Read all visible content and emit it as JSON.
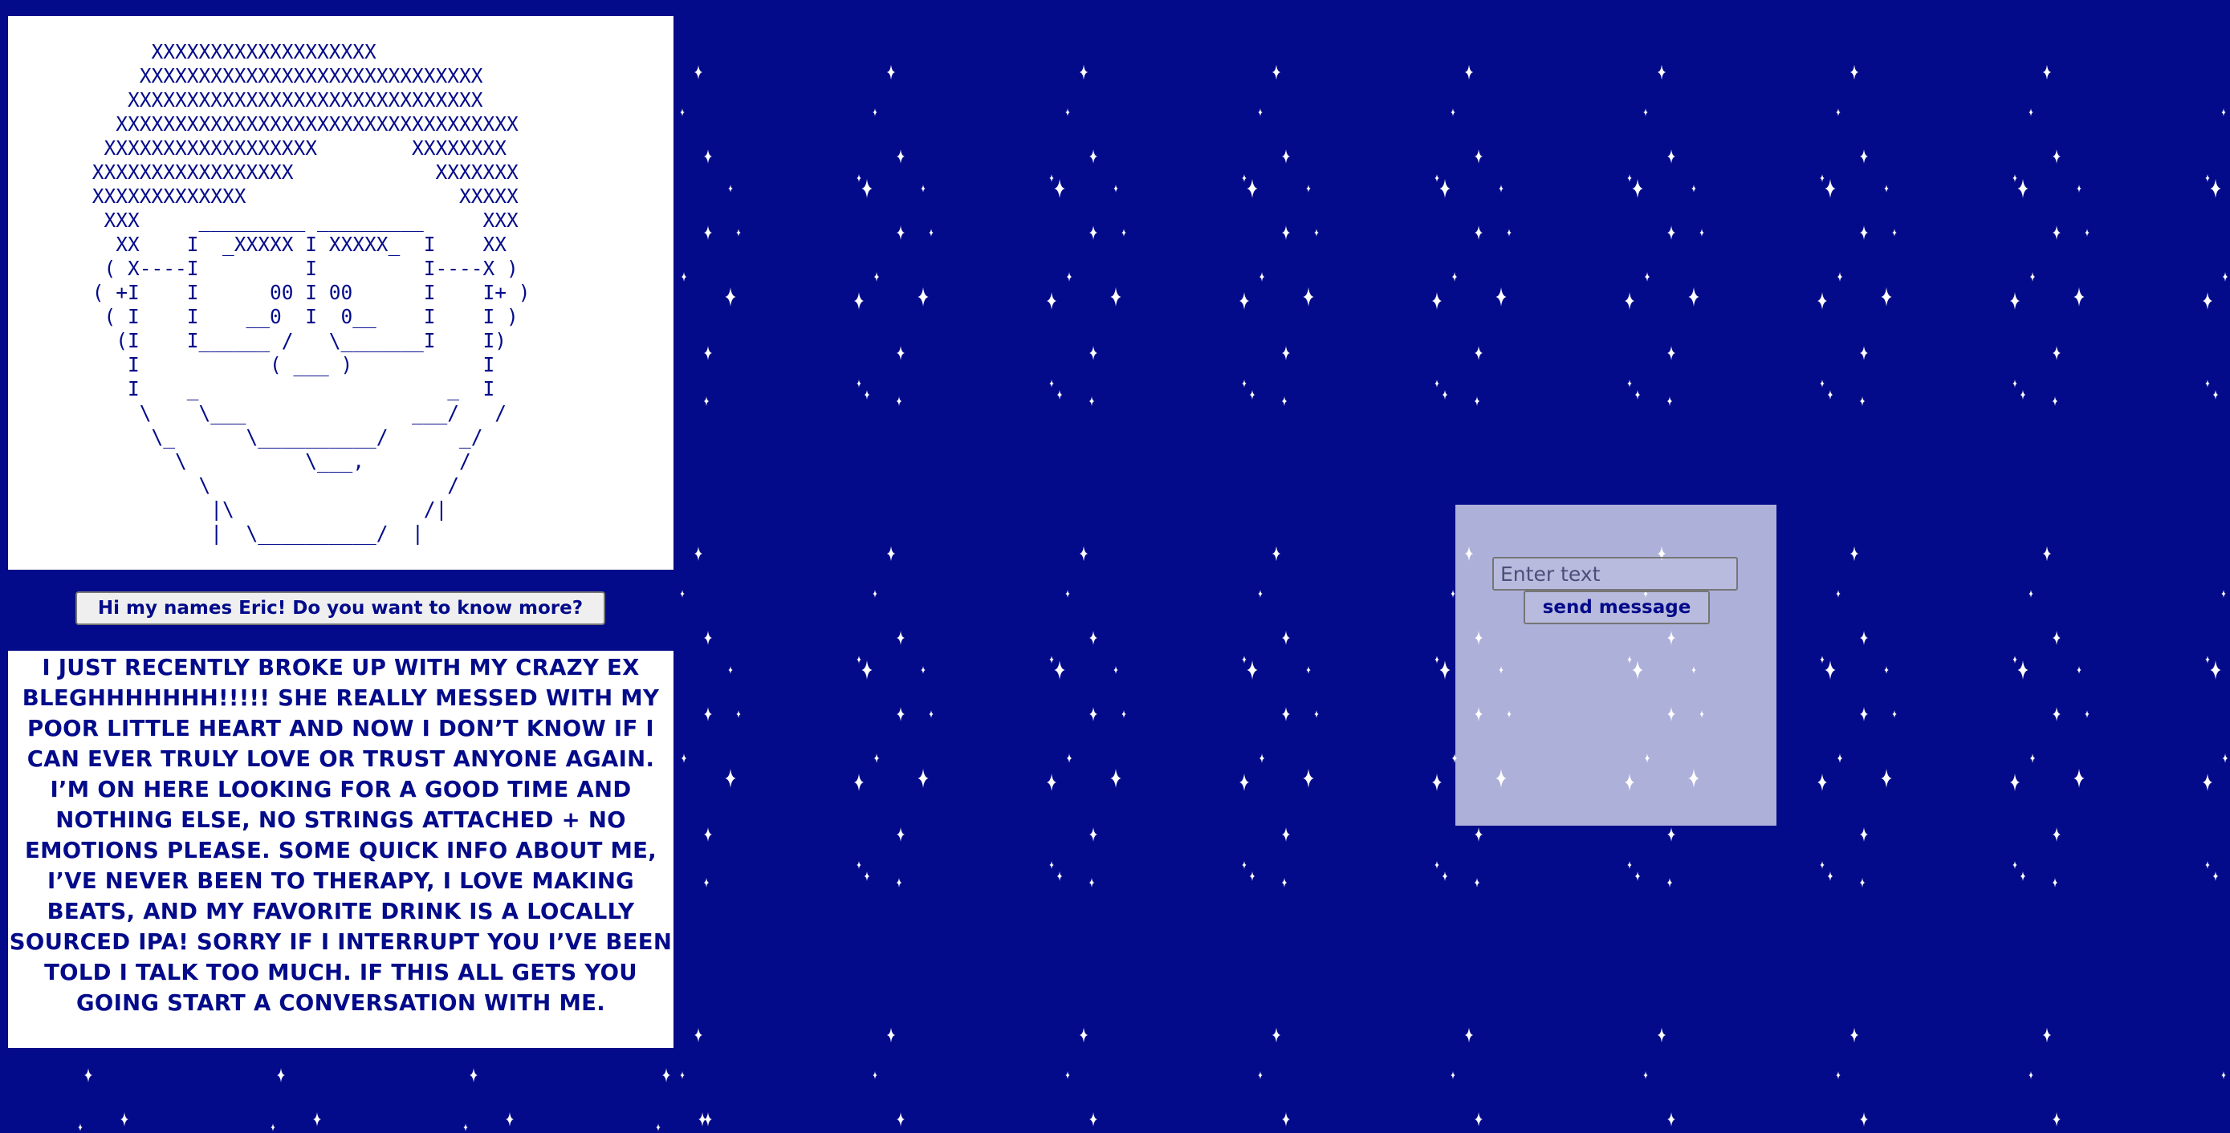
{
  "background": {
    "color": "#030b8a",
    "pattern": "sparkle-stars",
    "sparkle_color": "#ffffff"
  },
  "ascii_portrait": {
    "lines": [
      "      XXXXXXXXXXXXXXXXXXX",
      "     XXXXXXXXXXXXXXXXXXXXXXXXXXXXX",
      "    XXXXXXXXXXXXXXXXXXXXXXXXXXXXXX",
      "   XXXXXXXXXXXXXXXXXXXXXXXXXXXXXXXXXX",
      "  XXXXXXXXXXXXXXXXXX        XXXXXXXX",
      " XXXXXXXXXXXXXXXXX            XXXXXXX",
      " XXXXXXXXXXXXX                  XXXXX",
      "  XXX     _________ _________     XXX",
      "   XX    I  _XXXXX I XXXXX_  I    XX",
      "  ( X----I         I         I----X )",
      " ( +I    I      00 I 00      I    I+ )",
      "  ( I    I    __0  I  0__    I    I )",
      "   (I    I______ /   \\_______I    I)",
      "    I           ( ___ )           I",
      "    I    _                     _  I",
      "     \\    \\___              ___/   /",
      "      \\_      \\__________/      _/",
      "        \\          \\___,        /",
      "          \\                    /",
      "           |\\                /|",
      "           |  \\__________/  |"
    ]
  },
  "intro_button": {
    "label": "Hi my names Eric! Do you want to know more?"
  },
  "bio": {
    "text": "I JUST RECENTLY BROKE UP WITH MY CRAZY EX BLEGHHHHHHH!!!!! SHE REALLY MESSED WITH MY POOR LITTLE HEART AND NOW I DON’T KNOW IF I CAN EVER TRULY LOVE OR TRUST ANYONE AGAIN. I’M ON HERE LOOKING FOR A GOOD TIME AND NOTHING ELSE, NO STRINGS ATTACHED + NO EMOTIONS PLEASE. SOME QUICK INFO ABOUT ME, I’VE NEVER BEEN TO THERAPY, I LOVE MAKING BEATS, AND MY FAVORITE DRINK IS A LOCALLY SOURCED IPA! SORRY IF I INTERRUPT YOU I’VE BEEN TOLD I TALK TOO MUCH. IF THIS ALL GETS YOU GOING START A CONVERSATION WITH ME."
  },
  "chat": {
    "input_value": "",
    "input_placeholder": "Enter text",
    "send_label": "send message"
  },
  "colors": {
    "accent_text": "#030b8a",
    "panel_white": "#ffffff",
    "chat_panel": "#b0b3db"
  }
}
